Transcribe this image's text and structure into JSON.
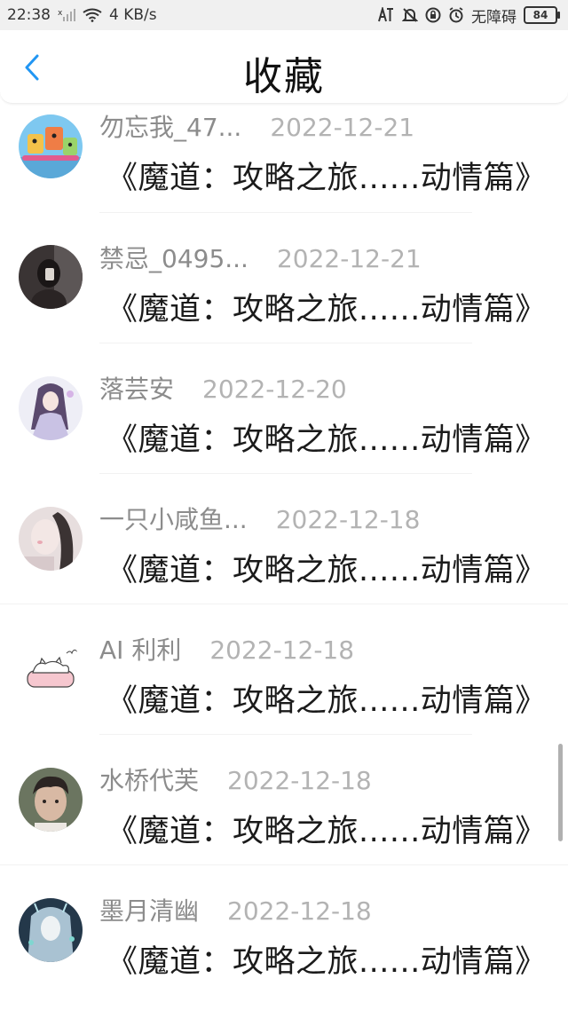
{
  "status_bar": {
    "time": "22:38",
    "network_speed": "4 KB/s",
    "accessibility_label": "无障碍",
    "battery": "84"
  },
  "header": {
    "title": "收藏"
  },
  "items": [
    {
      "username": "勿忘我_47...",
      "date": "2022-12-21",
      "title": "《魔道：攻略之旅......动情篇》",
      "avatar": "avatar-cartoon-animals"
    },
    {
      "username": "禁忌_0495...",
      "date": "2022-12-21",
      "title": "《魔道：攻略之旅......动情篇》",
      "avatar": "avatar-dark-portrait"
    },
    {
      "username": "落芸安",
      "date": "2022-12-20",
      "title": "《魔道：攻略之旅......动情篇》",
      "avatar": "avatar-anime-girl"
    },
    {
      "username": "一只小咸鱼...",
      "date": "2022-12-18",
      "title": "《魔道：攻略之旅......动情篇》",
      "avatar": "avatar-soft-portrait"
    },
    {
      "username": "AI 利利",
      "date": "2022-12-18",
      "title": "《魔道：攻略之旅......动情篇》",
      "avatar": "avatar-cat-bed"
    },
    {
      "username": "水桥代芙",
      "date": "2022-12-18",
      "title": "《魔道：攻略之旅......动情篇》",
      "avatar": "avatar-boy-portrait"
    },
    {
      "username": "墨月清幽",
      "date": "2022-12-18",
      "title": "《魔道：攻略之旅......动情篇》",
      "avatar": "avatar-fantasy-girl"
    }
  ]
}
